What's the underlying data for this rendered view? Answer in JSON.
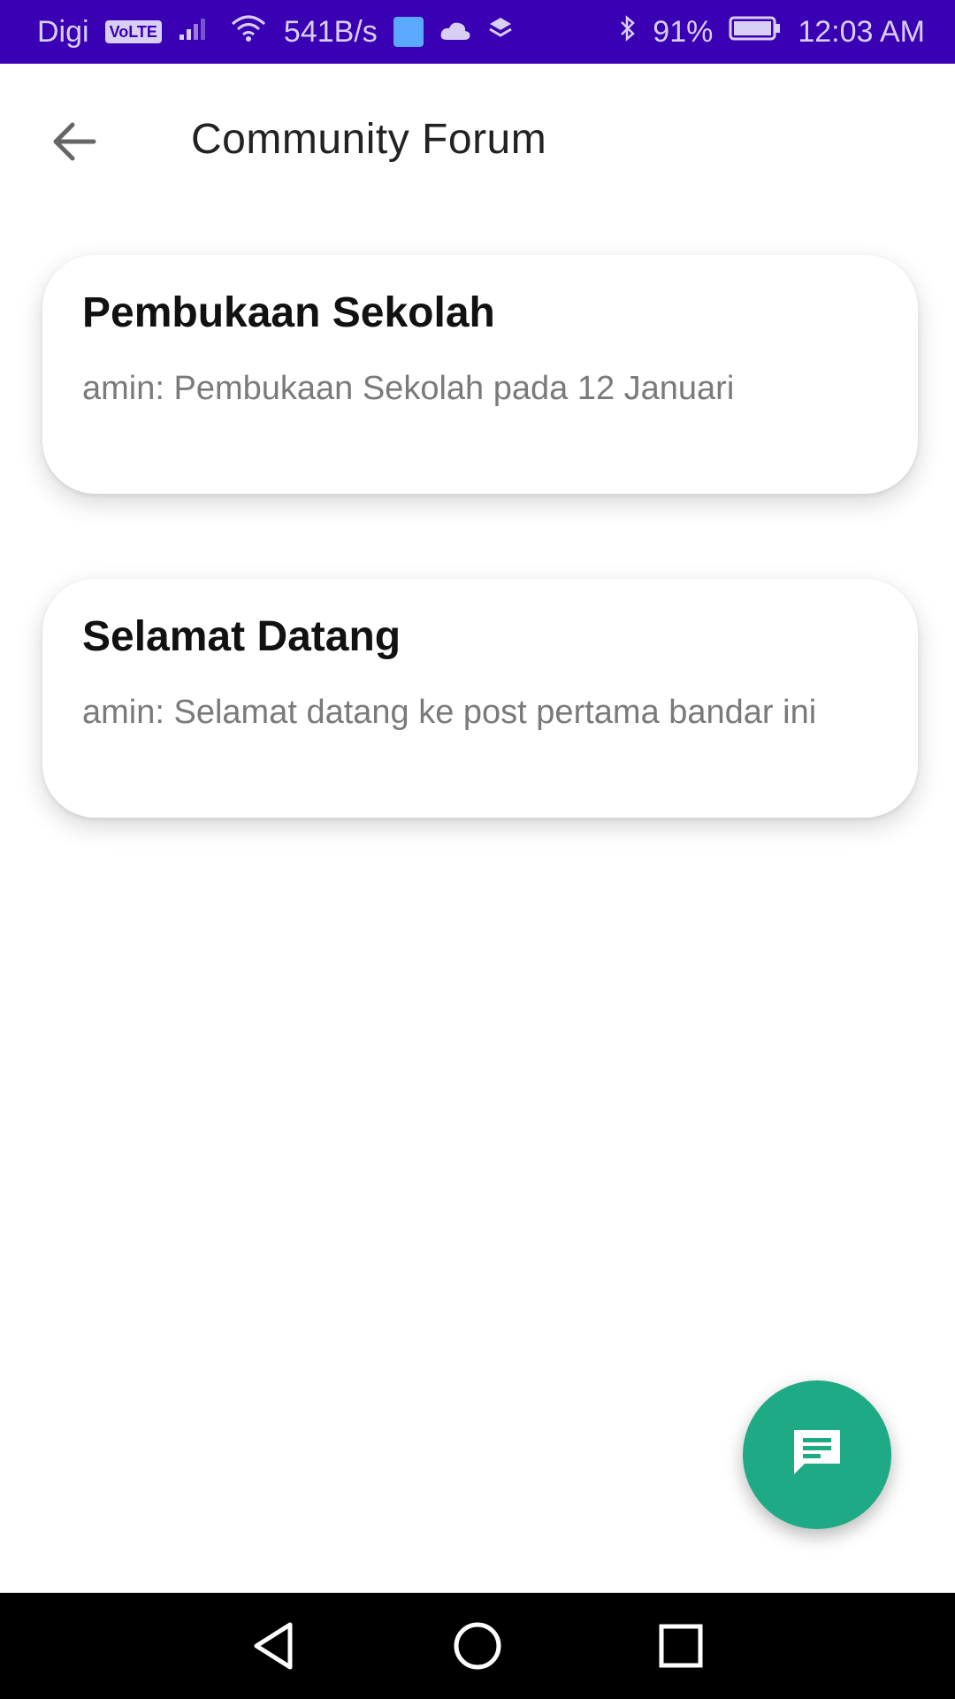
{
  "status_bar": {
    "carrier": "Digi",
    "volte": "VoLTE",
    "network_speed": "541B/s",
    "battery": "91%",
    "time": "12:03 AM",
    "accent_color": "#3a00b4"
  },
  "app_bar": {
    "title": "Community Forum",
    "back_icon": "arrow-left-icon"
  },
  "posts": [
    {
      "title": "Pembukaan Sekolah",
      "preview": "amin: Pembukaan Sekolah pada 12 Januari"
    },
    {
      "title": "Selamat Datang",
      "preview": "amin: Selamat datang ke post pertama bandar ini"
    }
  ],
  "fab": {
    "icon": "message-icon",
    "color": "#1eaa84"
  },
  "nav_bar": {
    "icons": [
      "back-triangle-icon",
      "home-circle-icon",
      "recents-square-icon"
    ]
  }
}
